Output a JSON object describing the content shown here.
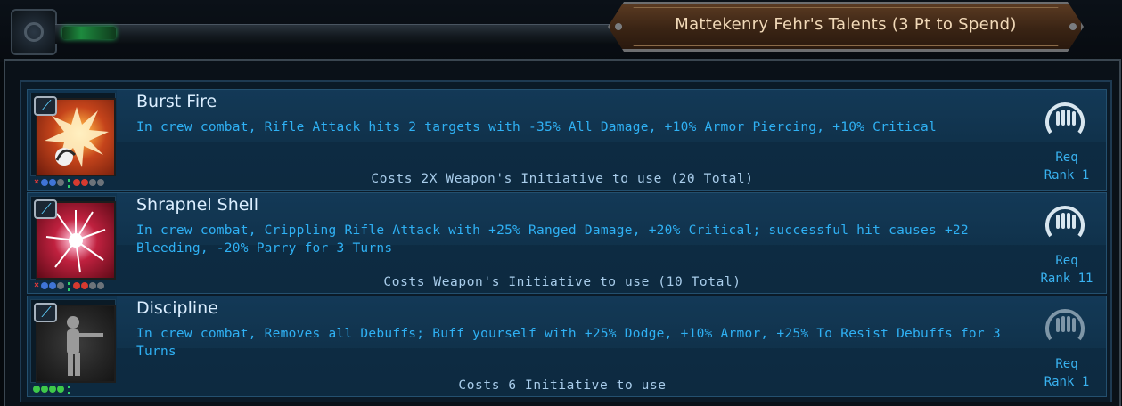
{
  "window": {
    "title": "Mattekenry Fehr's Talents (3 Pt to Spend)"
  },
  "talents": [
    {
      "name": "Burst Fire",
      "description": "In crew combat, Rifle Attack hits 2 targets with -35% All Damage, +10% Armor Piercing, +10% Critical",
      "cost": "Costs 2X Weapon's Initiative to use (20 Total)",
      "req_label": "Req",
      "rank": "Rank 1",
      "icon": "burst-explosion-art",
      "accent": "#c5441b"
    },
    {
      "name": "Shrapnel Shell",
      "description": "In crew combat, Crippling Rifle Attack with +25% Ranged Damage, +20% Critical; successful hit causes +22 Bleeding, -20% Parry for 3 Turns",
      "cost": "Costs Weapon's Initiative to use (10 Total)",
      "req_label": "Req",
      "rank": "Rank 11",
      "icon": "shrapnel-burst-art",
      "accent": "#c0213f"
    },
    {
      "name": "Discipline",
      "description": "In crew combat, Removes all Debuffs; Buff yourself with +25% Dodge, +10% Armor, +25% To Resist Debuffs for 3 Turns",
      "cost": "Costs 6 Initiative to use",
      "req_label": "Req",
      "rank": "Rank 1",
      "icon": "rifleman-silhouette-art",
      "accent": "#3d3d3d"
    }
  ],
  "colors": {
    "name_text": "#dbeeff",
    "description_text": "#2fb1f4",
    "cost_text": "#a9cdeb",
    "title_text": "#f1d9b8"
  }
}
